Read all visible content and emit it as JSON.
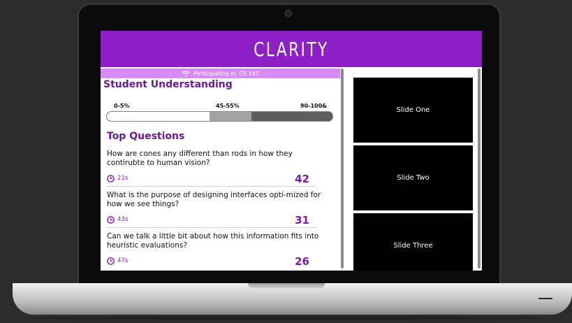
{
  "app": {
    "title": "CLARITY"
  },
  "status": {
    "participating": "Participating in: CS 147",
    "icon": "wifi-icon"
  },
  "understanding": {
    "title": "Student Understanding",
    "scale_labels": [
      "0-5%",
      "45-55%",
      "90-100&"
    ],
    "level_percent": 50
  },
  "questions": {
    "title": "Top Questions",
    "items": [
      {
        "text": "How are cones any different than rods in how they contirubte to human vision?",
        "time": "21s",
        "votes": "42"
      },
      {
        "text": "What is the purpose of designing interfaces opti-mized for how we see things?",
        "time": "43s",
        "votes": "31"
      },
      {
        "text": "Can we talk a little bit about how this information fits into heuristic evaluations?",
        "time": "47s",
        "votes": "26"
      }
    ]
  },
  "slides": {
    "items": [
      {
        "label": "Slide One"
      },
      {
        "label": "Slide Two"
      },
      {
        "label": "Slide Three"
      }
    ]
  },
  "colors": {
    "brand": "#8e1ec6",
    "status_bar": "#d78cf5",
    "heading": "#6a1a96"
  }
}
